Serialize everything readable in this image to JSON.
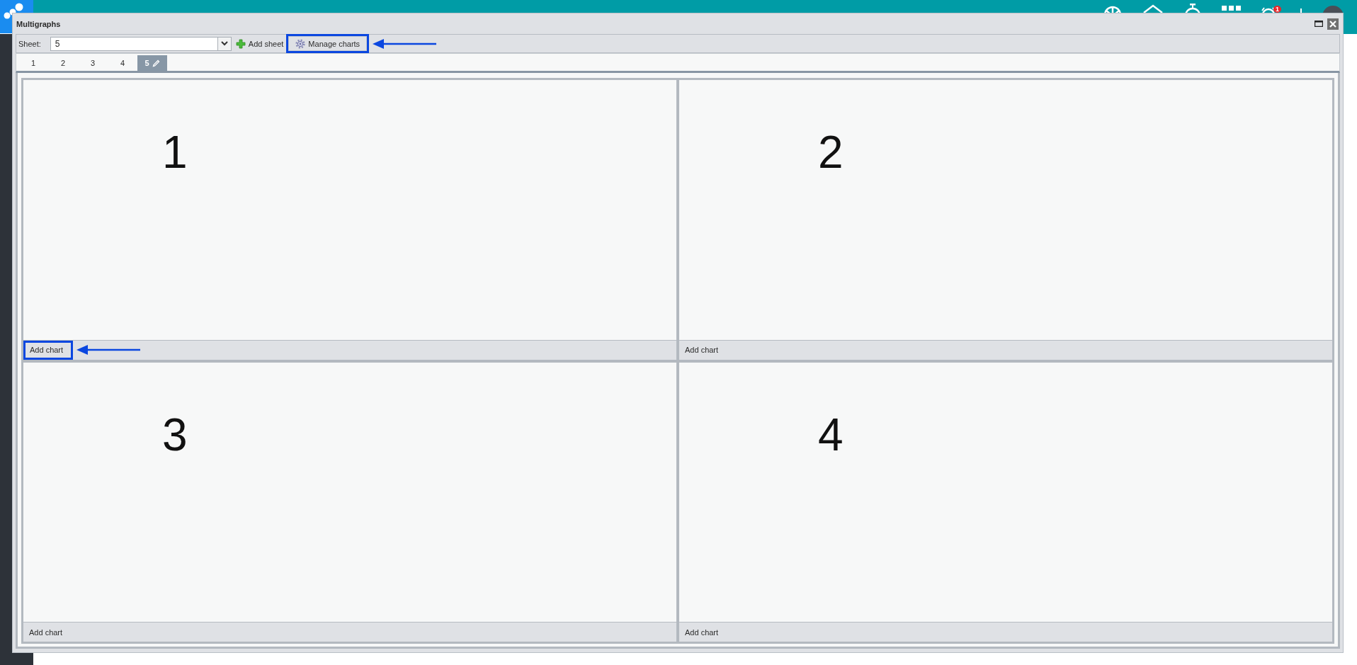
{
  "header": {
    "notification_count": "1"
  },
  "window": {
    "title": "Multigraphs"
  },
  "toolbar": {
    "sheet_label": "Sheet:",
    "sheet_select": {
      "value": "5"
    },
    "add_sheet": {
      "label": "Add sheet",
      "highlighted": false
    },
    "manage_charts": {
      "label": "Manage charts",
      "highlighted": true
    }
  },
  "tabs": [
    {
      "label": "1",
      "selected": false
    },
    {
      "label": "2",
      "selected": false
    },
    {
      "label": "3",
      "selected": false
    },
    {
      "label": "4",
      "selected": false
    },
    {
      "label": "5",
      "selected": true
    }
  ],
  "panels": [
    {
      "number": "1",
      "add_chart": {
        "label": "Add chart",
        "highlighted": true
      }
    },
    {
      "number": "2",
      "add_chart": {
        "label": "Add chart",
        "highlighted": false
      }
    },
    {
      "number": "3",
      "add_chart": {
        "label": "Add chart",
        "highlighted": false
      }
    },
    {
      "number": "4",
      "add_chart": {
        "label": "Add chart",
        "highlighted": false
      }
    }
  ]
}
